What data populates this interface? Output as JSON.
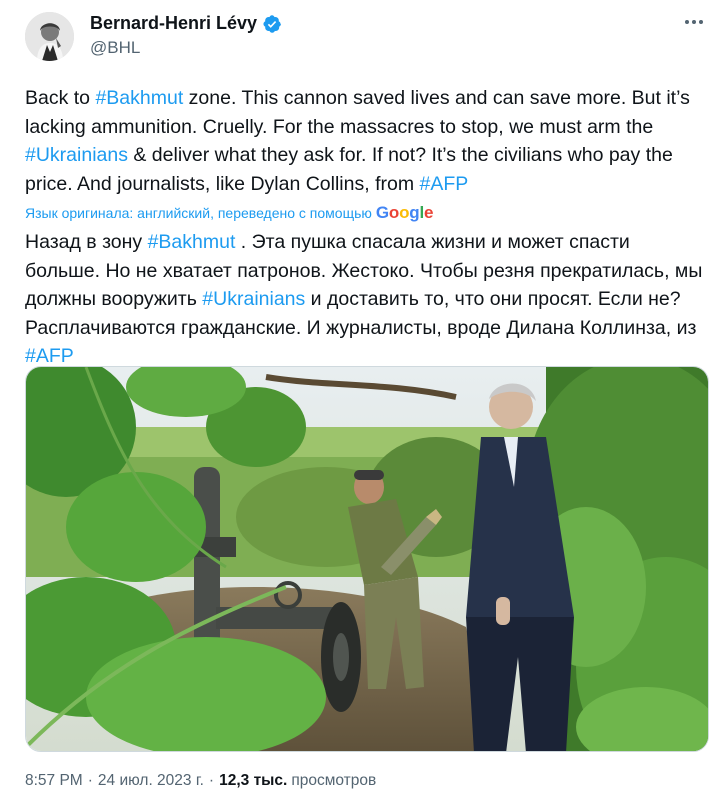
{
  "author": {
    "display_name": "Bernard-Henri Lévy",
    "handle": "@BHL",
    "verified": true
  },
  "tweet": {
    "english_segments": [
      {
        "t": "Back to ",
        "tag": false
      },
      {
        "t": "#Bakhmut",
        "tag": true
      },
      {
        "t": " zone. This cannon saved lives and can save more. But it’s lacking ammunition. Cruelly. For the massacres to stop, we must arm the ",
        "tag": false
      },
      {
        "t": "#Ukrainians",
        "tag": true
      },
      {
        "t": " & deliver what they ask for. If not? It’s the civilians who pay the price. And journalists, like Dylan Collins, from ",
        "tag": false
      },
      {
        "t": "#AFP",
        "tag": true
      }
    ],
    "translation_notice": "Язык оригинала: английский, переведено с помощью",
    "translation_provider": "Google",
    "translated_segments": [
      {
        "t": "Назад в зону ",
        "tag": false
      },
      {
        "t": "#Bakhmut",
        "tag": true
      },
      {
        "t": " . Эта пушка спасала жизни и может спасти больше. Но не хватает патронов. Жестоко. Чтобы резня прекратилась, мы должны вооружить ",
        "tag": false
      },
      {
        "t": "#Ukrainians",
        "tag": true
      },
      {
        "t": " и доставить то, что они просят. Если не? Расплачиваются гражданские. И журналисты, вроде Дилана Коллинза, из ",
        "tag": false
      },
      {
        "t": "#AFP",
        "tag": true
      }
    ]
  },
  "footer": {
    "time": "8:57 PM",
    "separator": "·",
    "date": "24 июл. 2023 г.",
    "views_count": "12,3 тыс.",
    "views_label": "просмотров"
  },
  "colors": {
    "accent": "#1d9bf0",
    "text": "#0f1419",
    "secondary": "#536471"
  },
  "icons": {
    "verified": "verified-badge-icon",
    "more": "more-horizontal-icon"
  }
}
